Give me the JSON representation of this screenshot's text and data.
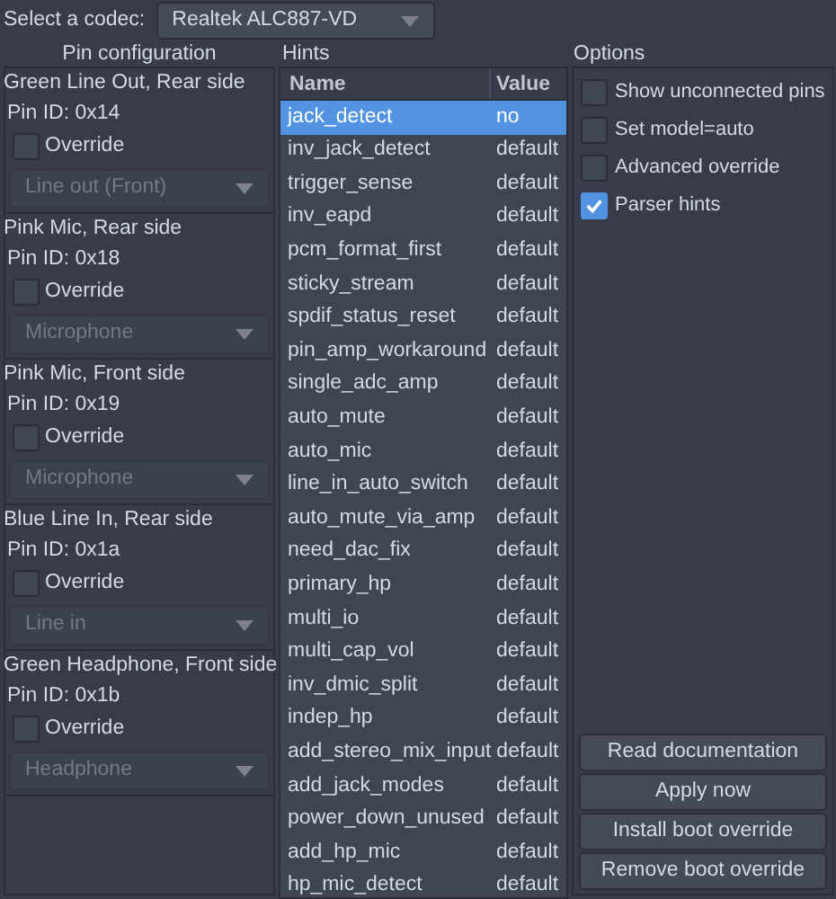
{
  "codec_select": {
    "label": "Select a codec:",
    "value": "Realtek ALC887-VD"
  },
  "pin_configuration": {
    "title": "Pin configuration",
    "pins": [
      {
        "name": "Green Line Out, Rear side",
        "pin_id": "Pin ID: 0x14",
        "override_label": "Override",
        "override": false,
        "type": "Line out (Front)"
      },
      {
        "name": "Pink Mic, Rear side",
        "pin_id": "Pin ID: 0x18",
        "override_label": "Override",
        "override": false,
        "type": "Microphone"
      },
      {
        "name": "Pink Mic, Front side",
        "pin_id": "Pin ID: 0x19",
        "override_label": "Override",
        "override": false,
        "type": "Microphone"
      },
      {
        "name": "Blue Line In, Rear side",
        "pin_id": "Pin ID: 0x1a",
        "override_label": "Override",
        "override": false,
        "type": "Line in"
      },
      {
        "name": "Green Headphone, Front side",
        "pin_id": "Pin ID: 0x1b",
        "override_label": "Override",
        "override": false,
        "type": "Headphone"
      }
    ]
  },
  "hints": {
    "title": "Hints",
    "columns": [
      "Name",
      "Value"
    ],
    "rows": [
      {
        "name": "jack_detect",
        "value": "no",
        "selected": true
      },
      {
        "name": "inv_jack_detect",
        "value": "default",
        "selected": false
      },
      {
        "name": "trigger_sense",
        "value": "default",
        "selected": false
      },
      {
        "name": "inv_eapd",
        "value": "default",
        "selected": false
      },
      {
        "name": "pcm_format_first",
        "value": "default",
        "selected": false
      },
      {
        "name": "sticky_stream",
        "value": "default",
        "selected": false
      },
      {
        "name": "spdif_status_reset",
        "value": "default",
        "selected": false
      },
      {
        "name": "pin_amp_workaround",
        "value": "default",
        "selected": false
      },
      {
        "name": "single_adc_amp",
        "value": "default",
        "selected": false
      },
      {
        "name": "auto_mute",
        "value": "default",
        "selected": false
      },
      {
        "name": "auto_mic",
        "value": "default",
        "selected": false
      },
      {
        "name": "line_in_auto_switch",
        "value": "default",
        "selected": false
      },
      {
        "name": "auto_mute_via_amp",
        "value": "default",
        "selected": false
      },
      {
        "name": "need_dac_fix",
        "value": "default",
        "selected": false
      },
      {
        "name": "primary_hp",
        "value": "default",
        "selected": false
      },
      {
        "name": "multi_io",
        "value": "default",
        "selected": false
      },
      {
        "name": "multi_cap_vol",
        "value": "default",
        "selected": false
      },
      {
        "name": "inv_dmic_split",
        "value": "default",
        "selected": false
      },
      {
        "name": "indep_hp",
        "value": "default",
        "selected": false
      },
      {
        "name": "add_stereo_mix_input",
        "value": "default",
        "selected": false
      },
      {
        "name": "add_jack_modes",
        "value": "default",
        "selected": false
      },
      {
        "name": "power_down_unused",
        "value": "default",
        "selected": false
      },
      {
        "name": "add_hp_mic",
        "value": "default",
        "selected": false
      },
      {
        "name": "hp_mic_detect",
        "value": "default",
        "selected": false
      }
    ]
  },
  "options": {
    "title": "Options",
    "items": [
      {
        "label": "Show unconnected pins",
        "checked": false
      },
      {
        "label": "Set model=auto",
        "checked": false
      },
      {
        "label": "Advanced override",
        "checked": false
      },
      {
        "label": "Parser hints",
        "checked": true
      }
    ]
  },
  "buttons": [
    "Read documentation",
    "Apply now",
    "Install boot override",
    "Remove boot override"
  ]
}
